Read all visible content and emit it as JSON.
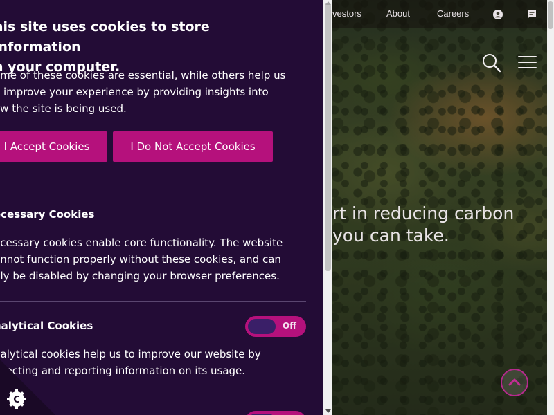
{
  "site": {
    "topnav": [
      {
        "label": "vestors"
      },
      {
        "label": "About"
      },
      {
        "label": "Careers"
      }
    ],
    "hero_lines": [
      "rt in reducing carbon",
      "you can take."
    ]
  },
  "cookie_panel": {
    "title": "his site uses cookies to store information n your computer.",
    "title_lines": [
      "his site uses cookies to store information",
      "n your computer."
    ],
    "intro_lines": [
      "ome of these cookies are essential, while others help us",
      "o improve your experience by providing insights into",
      "ow the site is being used."
    ],
    "accept_label": "I Accept Cookies",
    "decline_label": "I Do Not Accept Cookies",
    "sections": [
      {
        "title": "ecessary Cookies",
        "body_lines": [
          "ecessary cookies enable core functionality. The website",
          "annot function properly without these cookies, and can",
          "nly be disabled by changing your browser preferences."
        ]
      },
      {
        "title": "nalytical Cookies",
        "toggle_label": "Off",
        "body_lines": [
          "nalytical cookies help us to improve our website by",
          "ollecting and reporting information on its usage."
        ]
      }
    ]
  },
  "colors": {
    "panel_bg": "#230c36",
    "accent": "#b5117c",
    "toggle_knob": "#3a1f68"
  },
  "icons": {
    "account": "account-icon",
    "chat": "chat-icon",
    "search": "search-icon",
    "menu": "hamburger-menu-icon",
    "back_to_top": "chevron-up-icon",
    "cookie": "cookie-icon"
  }
}
